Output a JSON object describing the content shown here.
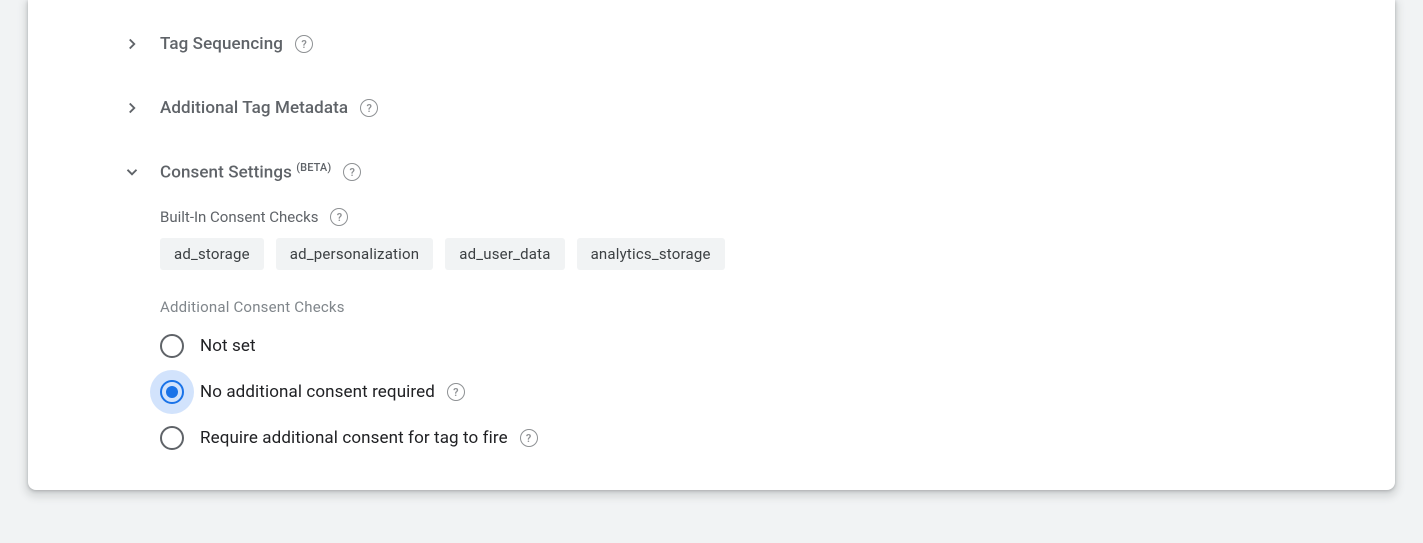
{
  "sections": {
    "tag_sequencing": {
      "title": "Tag Sequencing"
    },
    "additional_metadata": {
      "title": "Additional Tag Metadata"
    },
    "consent_settings": {
      "title": "Consent Settings ",
      "badge": "(BETA)",
      "builtin_label": "Built-In Consent Checks",
      "chips": [
        "ad_storage",
        "ad_personalization",
        "ad_user_data",
        "analytics_storage"
      ],
      "additional_label": "Additional Consent Checks",
      "options": {
        "not_set": {
          "label": "Not set",
          "selected": false,
          "help": false
        },
        "no_additional": {
          "label": "No additional consent required",
          "selected": true,
          "help": true
        },
        "require": {
          "label": "Require additional consent for tag to fire",
          "selected": false,
          "help": true
        }
      }
    }
  }
}
